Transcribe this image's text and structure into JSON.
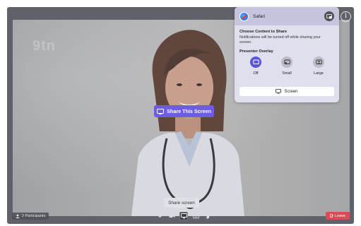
{
  "app": {
    "watermark": "9tn"
  },
  "share_overlay": {
    "label": "Share This Screen"
  },
  "popover": {
    "title": "Safari",
    "choose_title": "Choose Content to Share",
    "choose_desc": "Notifications will be turned off while sharing your screen.",
    "overlay_title": "Presenter Overlay",
    "options": [
      {
        "label": "Off",
        "icon": "screen-icon",
        "selected": true
      },
      {
        "label": "Small",
        "icon": "small-overlay-icon",
        "selected": false
      },
      {
        "label": "Large",
        "icon": "large-overlay-icon",
        "selected": false
      }
    ],
    "screen_button": "Screen"
  },
  "bottom_bar": {
    "participants": "2 Participants",
    "leave": "Leave",
    "controls": [
      {
        "icon": "microphone-icon"
      },
      {
        "icon": "camera-icon"
      },
      {
        "icon": "share-screen-icon",
        "active": true
      },
      {
        "icon": "captions-icon"
      },
      {
        "icon": "raise-hand-icon"
      }
    ]
  },
  "tooltip": "Share screen",
  "colors": {
    "accent": "#6d5de6",
    "leave": "#d94b52",
    "selected_option": "#5a55d8"
  }
}
